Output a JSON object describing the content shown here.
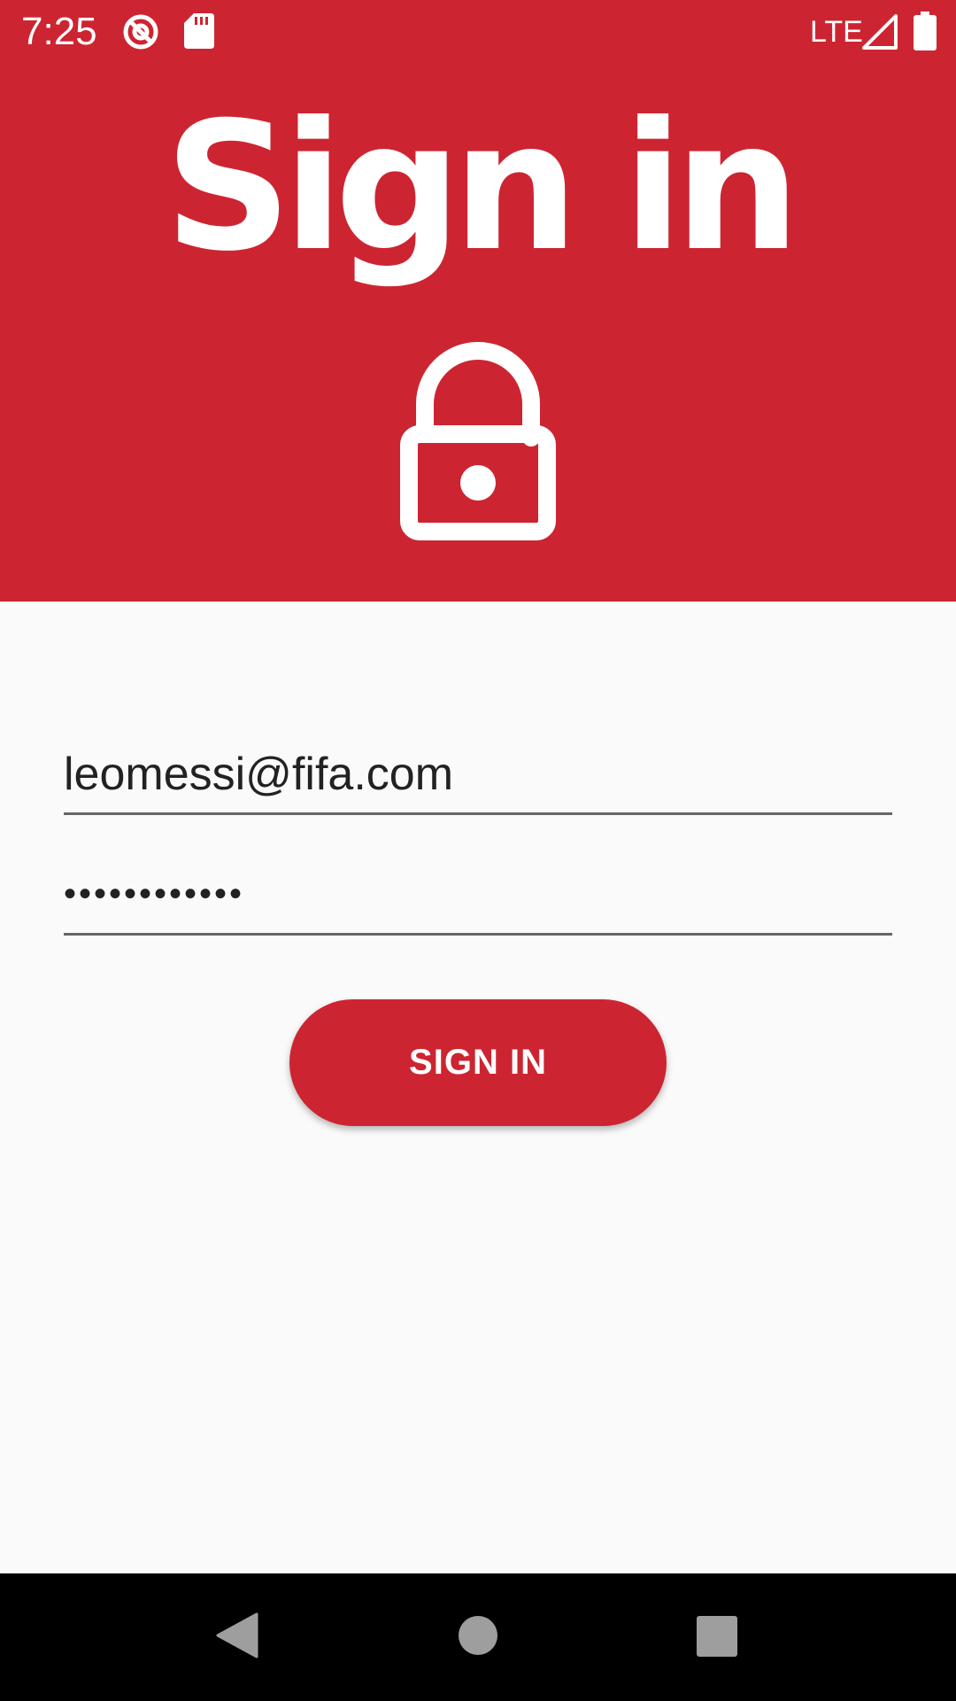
{
  "status_bar": {
    "time": "7:25",
    "network": "LTE",
    "icons": [
      "data-saver-icon",
      "sd-card-icon",
      "signal-icon",
      "battery-icon"
    ]
  },
  "header": {
    "title": "Sign in",
    "icon": "lock-open-icon",
    "background_color": "#cc2531"
  },
  "form": {
    "email_value": "leomessi@fifa.com",
    "password_value": "••••••••••••"
  },
  "sign_in_button": {
    "label": "SIGN IN",
    "color": "#cc2531"
  },
  "nav_bar": {
    "icons": [
      "back-icon",
      "home-icon",
      "recents-icon"
    ]
  }
}
